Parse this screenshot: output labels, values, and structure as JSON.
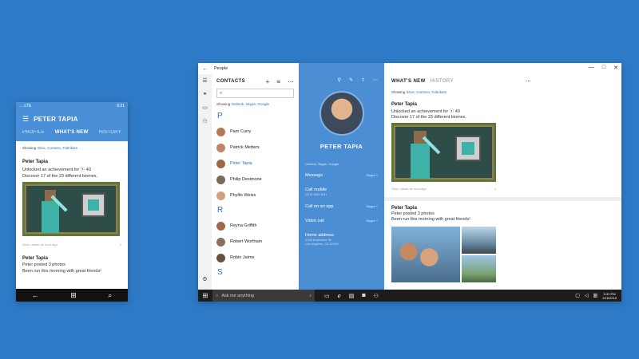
{
  "phone": {
    "status": {
      "left": "… LTE",
      "right": "9:21"
    },
    "title": "PETER TAPIA",
    "tabs": [
      "PROFILE",
      "WHAT'S NEW",
      "HISTORY"
    ],
    "active_tab": "WHAT'S NEW",
    "showing_label": "Showing",
    "showing_accounts": "Xbox, Contoso, Fabrikam",
    "post1": {
      "author": "Peter Tapia",
      "line1": "Unlocked an achievement for ⓧ 40",
      "line2": "Discover 17 of the 23 different biomes.",
      "time": "Xbox, about an hour ago",
      "comments": "1"
    },
    "post2": {
      "author": "Peter Tapia",
      "line1": "Peter posted 3 photos",
      "line2": "Been run this morning with great friends!"
    }
  },
  "window": {
    "title": "People",
    "controls": [
      "—",
      "□",
      "✕"
    ]
  },
  "contacts": {
    "title": "CONTACTS",
    "showing_label": "Showing",
    "showing_accounts": "Outlook, Skype, Google",
    "groups": [
      {
        "letter": "P",
        "items": [
          "Pam Curry",
          "Patrick Metters",
          "Peter Tapia",
          "Philip Desimone",
          "Phyllis Weiss"
        ]
      },
      {
        "letter": "R",
        "items": [
          "Reyna Griffith",
          "Robert Wortham",
          "Robin Jaime"
        ]
      },
      {
        "letter": "S",
        "items": []
      }
    ],
    "selected": "Peter Tapia"
  },
  "profile": {
    "name": "PETER TAPIA",
    "accounts": "Outlook, Skype, Google",
    "actions": [
      {
        "label": "Message",
        "sub": "",
        "service": "Skype ˅"
      },
      {
        "label": "Call mobile",
        "sub": "(212) 555-0151",
        "service": ""
      },
      {
        "label": "Call on an app",
        "sub": "",
        "service": "Skype ˅"
      },
      {
        "label": "Video call",
        "sub": "",
        "service": "Skype ˅"
      },
      {
        "label": "Home address",
        "sub": "2345 Anywhere St.\nLos Angeles, CA 12345",
        "service": ""
      }
    ]
  },
  "feed": {
    "tab_active": "WHAT'S NEW",
    "tab_other": "HISTORY",
    "showing_label": "Showing",
    "showing_accounts": "Xbox, Contoso, Fabrikam",
    "post1": {
      "author": "Peter Tapia",
      "line1": "Unlocked an achievement for ⓧ 40",
      "line2": "Discover 17 of the 23 different biomes.",
      "time": "Xbox, about an hour ago",
      "comments": "1"
    },
    "post2": {
      "author": "Peter Tapia",
      "line1": "Peter posted 3 photos",
      "line2": "Been run this morning with great friends!"
    }
  },
  "taskbar": {
    "search_placeholder": "Ask me anything",
    "time": "5:31 PM",
    "date": "2/16/2015"
  },
  "colors": {
    "accent": "#4b8ed3",
    "desktop": "#2f7ac7",
    "link": "#2f6fb6"
  }
}
